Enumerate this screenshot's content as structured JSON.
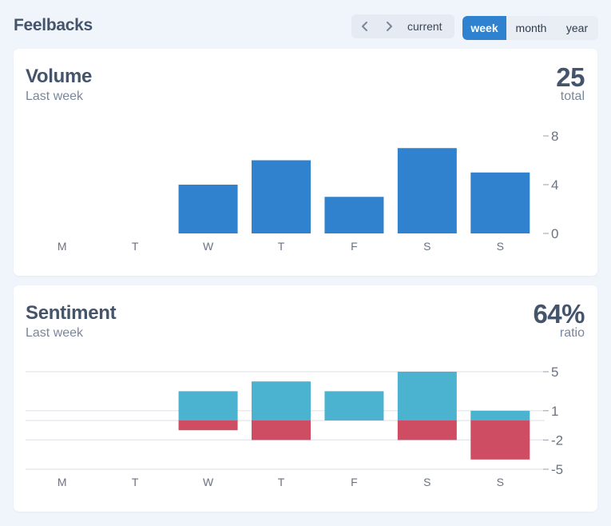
{
  "header": {
    "title": "Feelbacks",
    "nav": {
      "prev_icon": "chevron-left-icon",
      "next_icon": "chevron-right-icon",
      "current_label": "current"
    },
    "ranges": [
      {
        "label": "week",
        "active": true
      },
      {
        "label": "month",
        "active": false
      },
      {
        "label": "year",
        "active": false
      }
    ]
  },
  "colors": {
    "volume_bar": "#3182ce",
    "positive": "#4bb3cf",
    "negative": "#cf4d63",
    "active_range": "#2f82d0",
    "grid": "#e2e5ea",
    "axis_text": "#6b7280"
  },
  "volume": {
    "title": "Volume",
    "subtitle": "Last week",
    "stat": "25",
    "stat_label": "total"
  },
  "sentiment": {
    "title": "Sentiment",
    "subtitle": "Last week",
    "stat": "64%",
    "stat_label": "ratio"
  },
  "chart_data": [
    {
      "type": "bar",
      "title": "Volume",
      "categories": [
        "M",
        "T",
        "W",
        "T",
        "F",
        "S",
        "S"
      ],
      "values": [
        0,
        0,
        4,
        6,
        3,
        7,
        5
      ],
      "yticks": [
        0,
        4,
        8
      ],
      "ylim": [
        0,
        8
      ],
      "xlabel": "",
      "ylabel": "",
      "grid": false,
      "axis_position": "right"
    },
    {
      "type": "bar",
      "title": "Sentiment",
      "stacked": true,
      "categories": [
        "M",
        "T",
        "W",
        "T",
        "F",
        "S",
        "S"
      ],
      "series": [
        {
          "name": "positive",
          "values": [
            0,
            0,
            3,
            4,
            3,
            5,
            1
          ]
        },
        {
          "name": "negative",
          "values": [
            0,
            0,
            -1,
            -2,
            0,
            -2,
            -4
          ]
        }
      ],
      "yticks": [
        5,
        1,
        -2,
        -5
      ],
      "ylim": [
        -5,
        5
      ],
      "xlabel": "",
      "ylabel": "",
      "grid": true,
      "axis_position": "right"
    }
  ]
}
